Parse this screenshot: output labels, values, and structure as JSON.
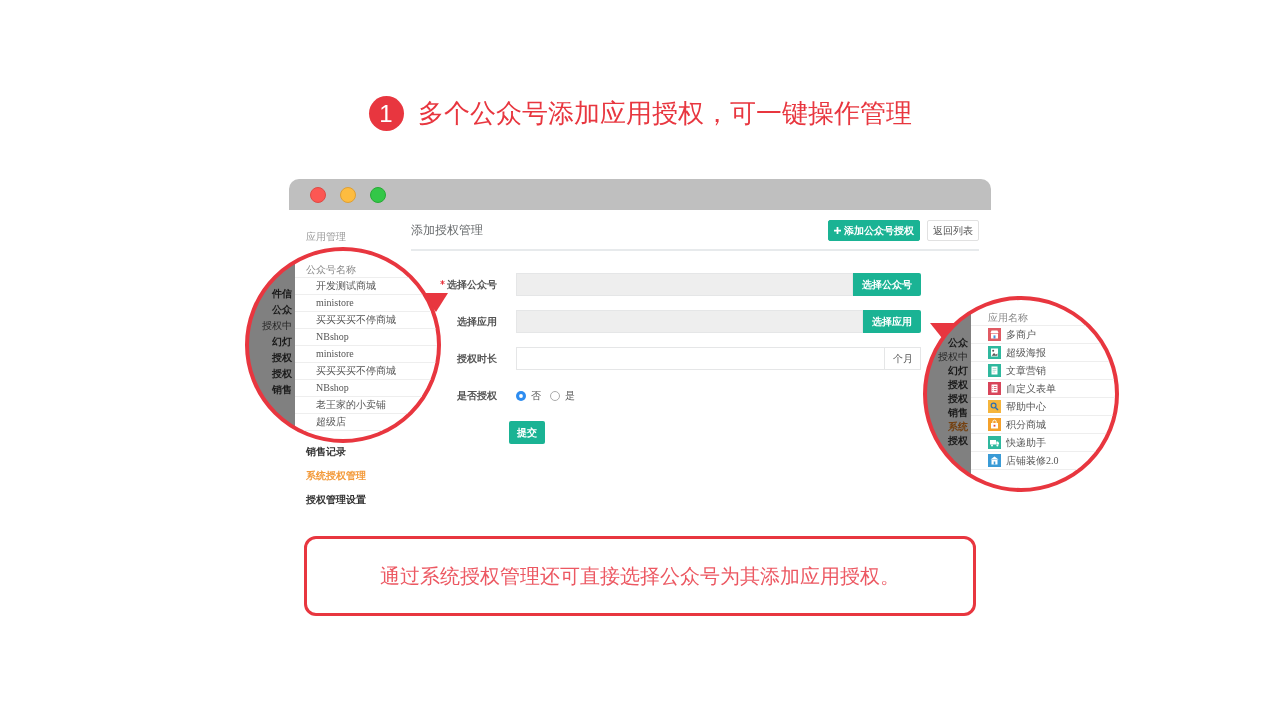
{
  "heading": {
    "step": "1",
    "title": "多个公众号添加应用授权，可一键操作管理"
  },
  "window": {
    "sidebar": {
      "section": "应用管理",
      "items": [
        {
          "label": "销售记录",
          "selected": false
        },
        {
          "label": "系统授权管理",
          "selected": true
        },
        {
          "label": "授权管理设置",
          "selected": false
        }
      ]
    },
    "page_title": "添加授权管理",
    "actions": [
      {
        "kind": "add",
        "label": "添加公众号授权"
      },
      {
        "kind": "back",
        "label": "返回列表"
      }
    ],
    "form": {
      "fields": [
        {
          "kind": "picker",
          "label": "选择公众号",
          "required": true,
          "button": "选择公众号"
        },
        {
          "kind": "picker",
          "label": "选择应用",
          "required": false,
          "button": "选择应用"
        },
        {
          "kind": "unit",
          "label": "授权时长",
          "required": false,
          "unit": "个月"
        },
        {
          "kind": "radio",
          "label": "是否授权",
          "required": false,
          "options": [
            {
              "label": "否",
              "selected": true
            },
            {
              "label": "是",
              "selected": false
            }
          ]
        }
      ],
      "submit": "提交"
    }
  },
  "magnifiers": [
    {
      "kind": "accounts",
      "side_menu": [
        {
          "kind": "item",
          "label": "件信",
          "selected": false
        },
        {
          "kind": "item",
          "label": "公众",
          "selected": false
        },
        {
          "kind": "section",
          "label": "授权中",
          "selected": false
        },
        {
          "kind": "item",
          "label": "幻灯",
          "selected": false
        },
        {
          "kind": "item",
          "label": "授权",
          "selected": false
        },
        {
          "kind": "item",
          "label": "授权",
          "selected": false
        },
        {
          "kind": "item",
          "label": "销售",
          "selected": false
        }
      ],
      "list_header": "公众号名称",
      "items": [
        {
          "label": "开发测试商城"
        },
        {
          "label": "ministore"
        },
        {
          "label": "买买买买不停商城"
        },
        {
          "label": "NBshop"
        },
        {
          "label": "ministore"
        },
        {
          "label": "买买买买不停商城"
        },
        {
          "label": "NBshop"
        },
        {
          "label": "老王家的小卖铺"
        },
        {
          "label": "超级店"
        }
      ]
    },
    {
      "kind": "apps",
      "side_menu": [
        {
          "kind": "item",
          "label": "公众",
          "selected": false
        },
        {
          "kind": "section",
          "label": "授权中",
          "selected": false
        },
        {
          "kind": "item",
          "label": "幻灯",
          "selected": false
        },
        {
          "kind": "item",
          "label": "授权",
          "selected": false
        },
        {
          "kind": "item",
          "label": "授权",
          "selected": false
        },
        {
          "kind": "item",
          "label": "销售",
          "selected": false
        },
        {
          "kind": "item",
          "label": "系统",
          "selected": true
        },
        {
          "kind": "item",
          "label": "授权",
          "selected": false
        }
      ],
      "list_header": "应用名称",
      "items": [
        {
          "label": "多商户",
          "color": "#e05a63"
        },
        {
          "label": "超级海报",
          "color": "#2fb89e"
        },
        {
          "label": "文章营销",
          "color": "#2fb89e"
        },
        {
          "label": "自定义表单",
          "color": "#d8455a"
        },
        {
          "label": "帮助中心",
          "color": "#f5b53c"
        },
        {
          "label": "积分商城",
          "color": "#f5a12b"
        },
        {
          "label": "快递助手",
          "color": "#2fb89e"
        },
        {
          "label": "店铺装修2.0",
          "color": "#3a9bd6"
        }
      ]
    }
  ],
  "caption": "通过系统授权管理还可直接选择公众号为其添加应用授权。"
}
